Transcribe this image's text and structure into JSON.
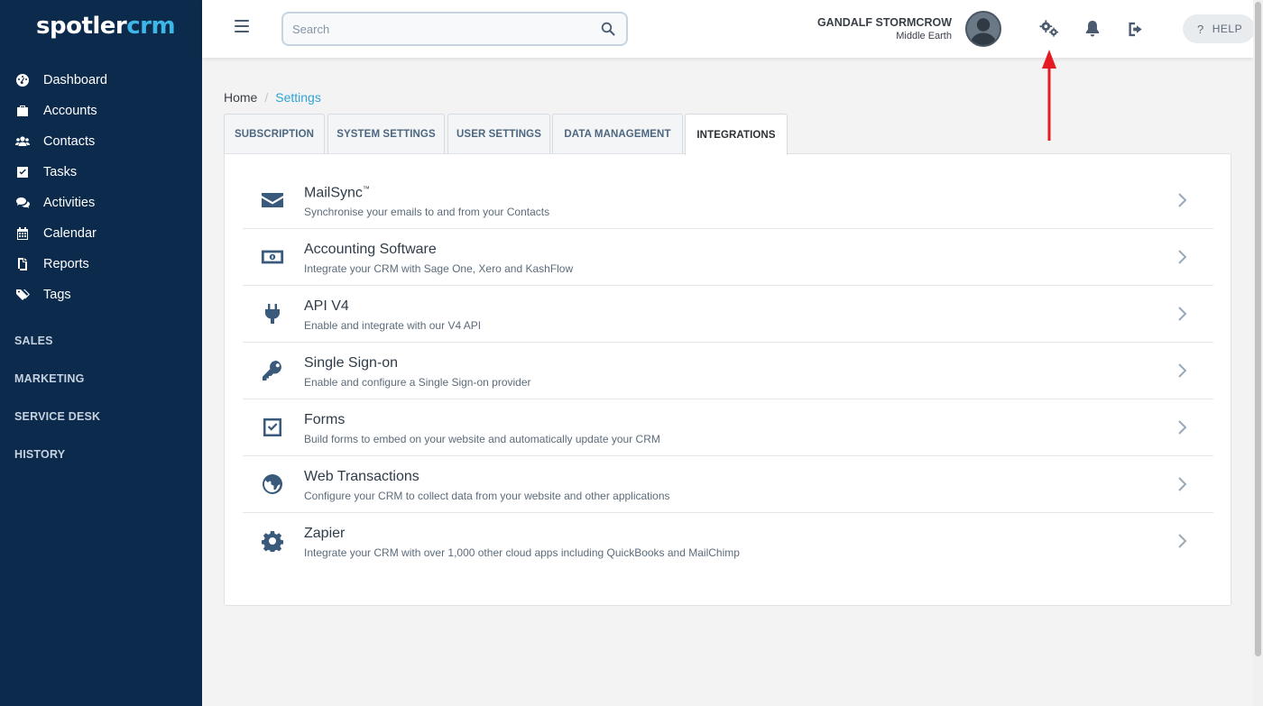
{
  "logo": {
    "part1": "spotler",
    "part2": "crm"
  },
  "colors": {
    "sidebar": "#0c2a4b",
    "accent": "#2fa3d6",
    "logo_accent": "#3fb6e8",
    "annotation": "#e31b23"
  },
  "sidebar": {
    "items": [
      {
        "label": "Dashboard",
        "icon": "dashboard-icon"
      },
      {
        "label": "Accounts",
        "icon": "briefcase-icon"
      },
      {
        "label": "Contacts",
        "icon": "users-icon"
      },
      {
        "label": "Tasks",
        "icon": "checkbox-icon"
      },
      {
        "label": "Activities",
        "icon": "comments-icon"
      },
      {
        "label": "Calendar",
        "icon": "calendar-icon"
      },
      {
        "label": "Reports",
        "icon": "files-icon"
      },
      {
        "label": "Tags",
        "icon": "tags-icon"
      }
    ],
    "sections": [
      "SALES",
      "MARKETING",
      "SERVICE DESK",
      "HISTORY"
    ]
  },
  "header": {
    "search_placeholder": "Search",
    "user_name": "GANDALF STORMCROW",
    "user_location": "Middle Earth",
    "help_label": "HELP",
    "help_glyph": "?"
  },
  "breadcrumb": {
    "home": "Home",
    "separator": "/",
    "current": "Settings"
  },
  "tabs": [
    {
      "label": "SUBSCRIPTION",
      "active": false
    },
    {
      "label": "SYSTEM SETTINGS",
      "active": false
    },
    {
      "label": "USER SETTINGS",
      "active": false
    },
    {
      "label": "DATA MANAGEMENT",
      "active": false
    },
    {
      "label": "INTEGRATIONS",
      "active": true
    }
  ],
  "integrations": [
    {
      "title": "MailSync",
      "title_sup": "™",
      "desc": "Synchronise your emails to and from your Contacts",
      "icon": "envelope-icon"
    },
    {
      "title": "Accounting Software",
      "title_sup": "",
      "desc": "Integrate your CRM with Sage One, Xero and KashFlow",
      "icon": "money-icon"
    },
    {
      "title": "API V4",
      "title_sup": "",
      "desc": "Enable and integrate with our V4 API",
      "icon": "plug-icon"
    },
    {
      "title": "Single Sign-on",
      "title_sup": "",
      "desc": "Enable and configure a Single Sign-on provider",
      "icon": "key-icon"
    },
    {
      "title": "Forms",
      "title_sup": "",
      "desc": "Build forms to embed on your website and automatically update your CRM",
      "icon": "form-check-icon"
    },
    {
      "title": "Web Transactions",
      "title_sup": "",
      "desc": "Configure your CRM to collect data from your website and other applications",
      "icon": "globe-icon"
    },
    {
      "title": "Zapier",
      "title_sup": "",
      "desc": "Integrate your CRM with over 1,000 other cloud apps including QuickBooks and MailChimp",
      "icon": "cog-icon"
    }
  ]
}
